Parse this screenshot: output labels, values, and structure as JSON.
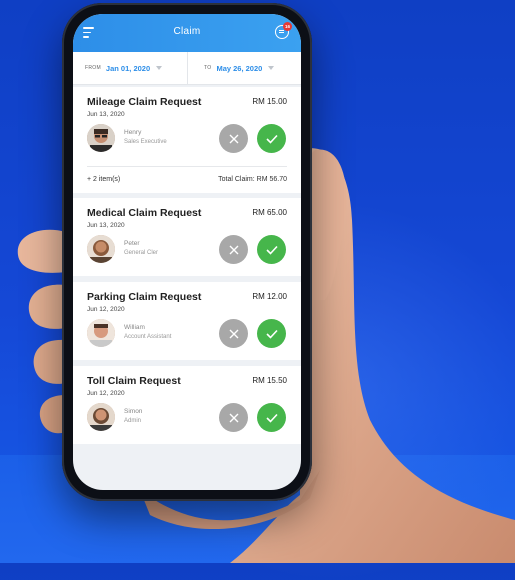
{
  "app": {
    "title": "Claim",
    "notification_count": "16"
  },
  "filter": {
    "from_label": "FROM",
    "from_value": "Jan 01, 2020",
    "to_label": "TO",
    "to_value": "May 26, 2020"
  },
  "claims": [
    {
      "title": "Mileage Claim Request",
      "amount": "RM 15.00",
      "date": "Jun 13, 2020",
      "name": "Henry",
      "role": "Sales Executive",
      "more_items": "+ 2 item(s)",
      "total": "Total Claim: RM 56.70"
    },
    {
      "title": "Medical Claim Request",
      "amount": "RM 65.00",
      "date": "Jun 13, 2020",
      "name": "Peter",
      "role": "General Cler"
    },
    {
      "title": "Parking Claim Request",
      "amount": "RM 12.00",
      "date": "Jun 12, 2020",
      "name": "William",
      "role": "Account Assistant"
    },
    {
      "title": "Toll Claim Request",
      "amount": "RM 15.50",
      "date": "Jun 12, 2020",
      "name": "Simon",
      "role": "Admin"
    }
  ],
  "colors": {
    "accent": "#2d8ee8",
    "approve": "#46b64b",
    "reject": "#a8a8a8",
    "background": "#1548d6"
  },
  "icons": {
    "menu": "menu-icon",
    "chat": "chat-icon",
    "reject": "close-icon",
    "approve": "check-icon",
    "caret": "caret-down-icon"
  }
}
